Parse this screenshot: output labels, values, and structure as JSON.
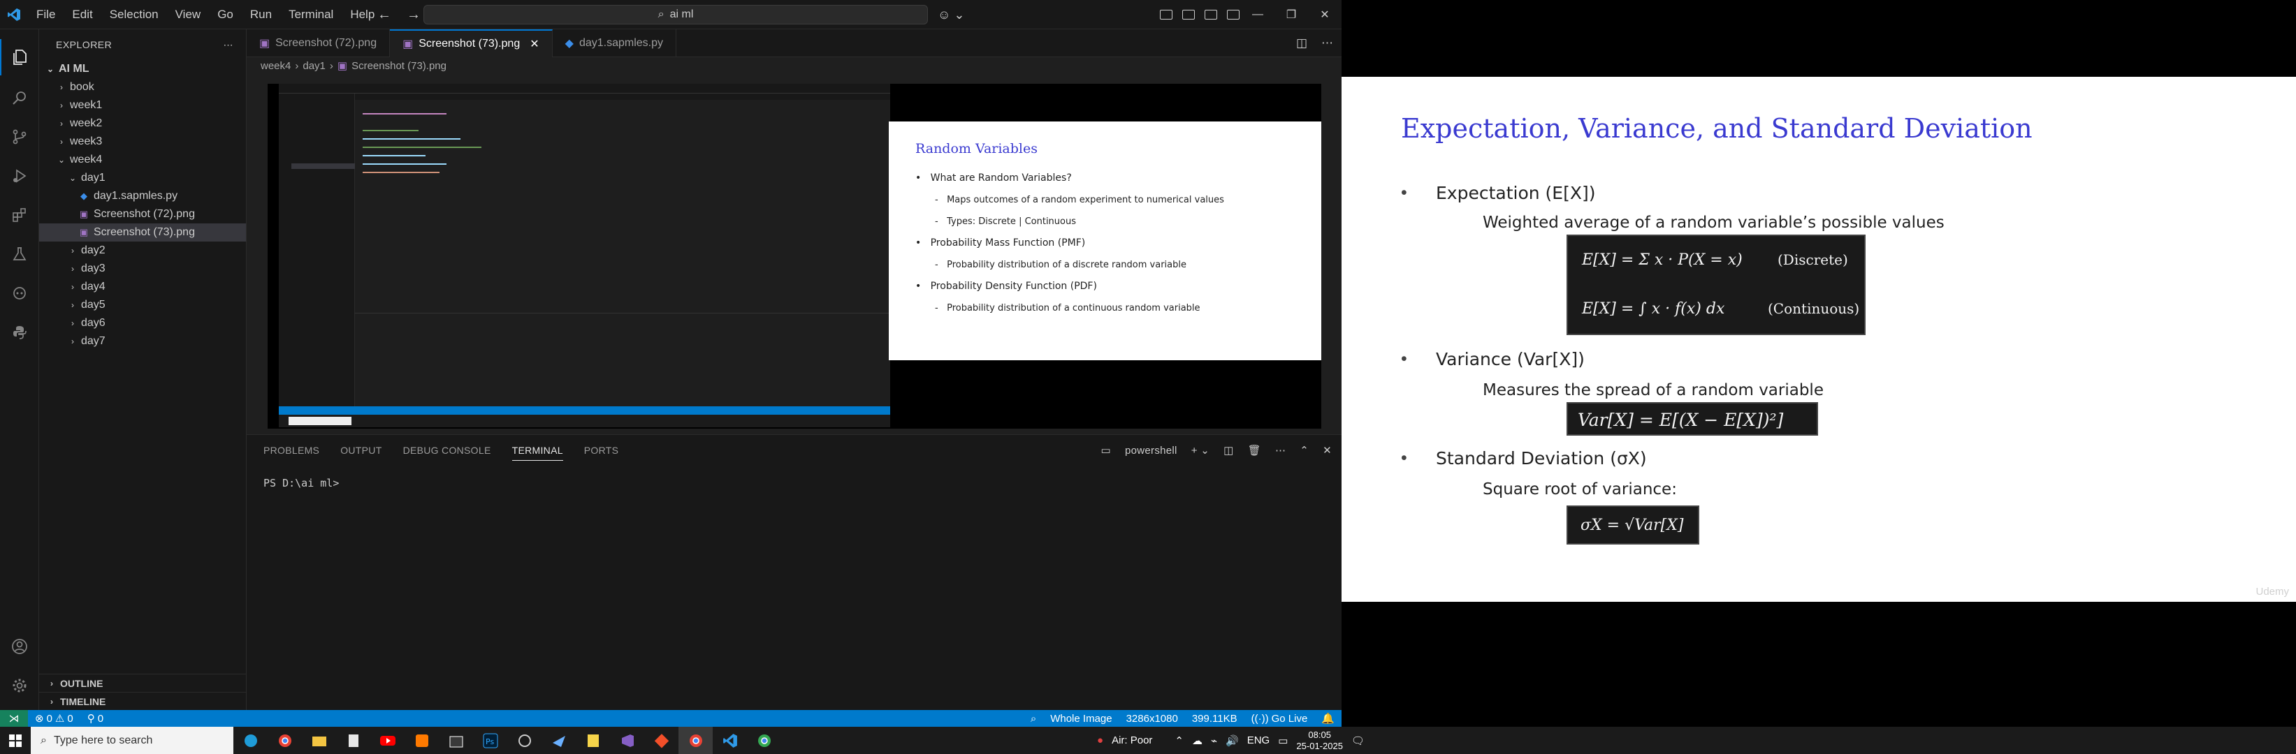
{
  "titlebar": {
    "menus": [
      "File",
      "Edit",
      "Selection",
      "View",
      "Go",
      "Run",
      "Terminal",
      "Help"
    ],
    "search_text": "ai ml"
  },
  "sidebar": {
    "title": "EXPLORER",
    "root": "AI ML",
    "items": [
      {
        "label": "book",
        "type": "folder",
        "open": false,
        "depth": 1
      },
      {
        "label": "week1",
        "type": "folder",
        "open": false,
        "depth": 1
      },
      {
        "label": "week2",
        "type": "folder",
        "open": false,
        "depth": 1
      },
      {
        "label": "week3",
        "type": "folder",
        "open": false,
        "depth": 1
      },
      {
        "label": "week4",
        "type": "folder",
        "open": true,
        "depth": 1
      },
      {
        "label": "day1",
        "type": "folder",
        "open": true,
        "depth": 2
      },
      {
        "label": "day1.sapmles.py",
        "type": "py",
        "depth": 3
      },
      {
        "label": "Screenshot (72).png",
        "type": "png",
        "depth": 3
      },
      {
        "label": "Screenshot (73).png",
        "type": "png",
        "depth": 3,
        "selected": true
      },
      {
        "label": "day2",
        "type": "folder",
        "open": false,
        "depth": 2
      },
      {
        "label": "day3",
        "type": "folder",
        "open": false,
        "depth": 2
      },
      {
        "label": "day4",
        "type": "folder",
        "open": false,
        "depth": 2
      },
      {
        "label": "day5",
        "type": "folder",
        "open": false,
        "depth": 2
      },
      {
        "label": "day6",
        "type": "folder",
        "open": false,
        "depth": 2
      },
      {
        "label": "day7",
        "type": "folder",
        "open": false,
        "depth": 2
      }
    ],
    "outline": "OUTLINE",
    "timeline": "TIMELINE"
  },
  "editor": {
    "tabs": [
      {
        "label": "Screenshot (72).png",
        "icon": "image-icon"
      },
      {
        "label": "Screenshot (73).png",
        "icon": "image-icon",
        "active": true
      },
      {
        "label": "day1.sapmles.py",
        "icon": "python-icon"
      }
    ],
    "breadcrumb": [
      "week4",
      "day1",
      "Screenshot (73).png"
    ]
  },
  "inner_slide": {
    "title": "Random Variables",
    "bullets": [
      "What are Random Variables?",
      "Maps outcomes of a random experiment to numerical values",
      "Types: Discrete | Continuous",
      "Probability Mass Function (PMF)",
      "Probability distribution of a discrete random variable",
      "Probability Density Function (PDF)",
      "Probability distribution of a continuous random variable"
    ]
  },
  "panel": {
    "tabs": [
      "PROBLEMS",
      "OUTPUT",
      "DEBUG CONSOLE",
      "TERMINAL",
      "PORTS"
    ],
    "shell": "powershell",
    "prompt": "PS D:\\ai ml>"
  },
  "statusbar": {
    "errors": "0",
    "warnings": "0",
    "ports": "0",
    "image_label": "Whole Image",
    "dimensions": "3286x1080",
    "filesize": "399.11KB",
    "golive": "Go Live"
  },
  "slide": {
    "title": "Expectation, Variance, and Standard Deviation",
    "b1": "Expectation (E[X])",
    "b1_sub": "Weighted average of a random variable’s possible values",
    "f1a": "E[X] = Σ x · P(X = x)",
    "f1a_tag": "(Discrete)",
    "f1b": "E[X] = ∫ x · f(x) dx",
    "f1b_tag": "(Continuous)",
    "b2": "Variance (Var[X])",
    "b2_sub": "Measures the spread of a random variable",
    "f2": "Var[X] = E[(X − E[X])²]",
    "b3": "Standard Deviation (σX)",
    "b3_sub": "Square root of variance:",
    "f3": "σX = √Var[X]",
    "watermark": "Udemy"
  },
  "taskbar": {
    "search_placeholder": "Type here to search",
    "weather": "Air: Poor",
    "lang": "ENG",
    "time": "08:05",
    "date": "25-01-2025"
  },
  "colors": {
    "accent": "#007acc",
    "slide_title": "#3a3ad0"
  }
}
